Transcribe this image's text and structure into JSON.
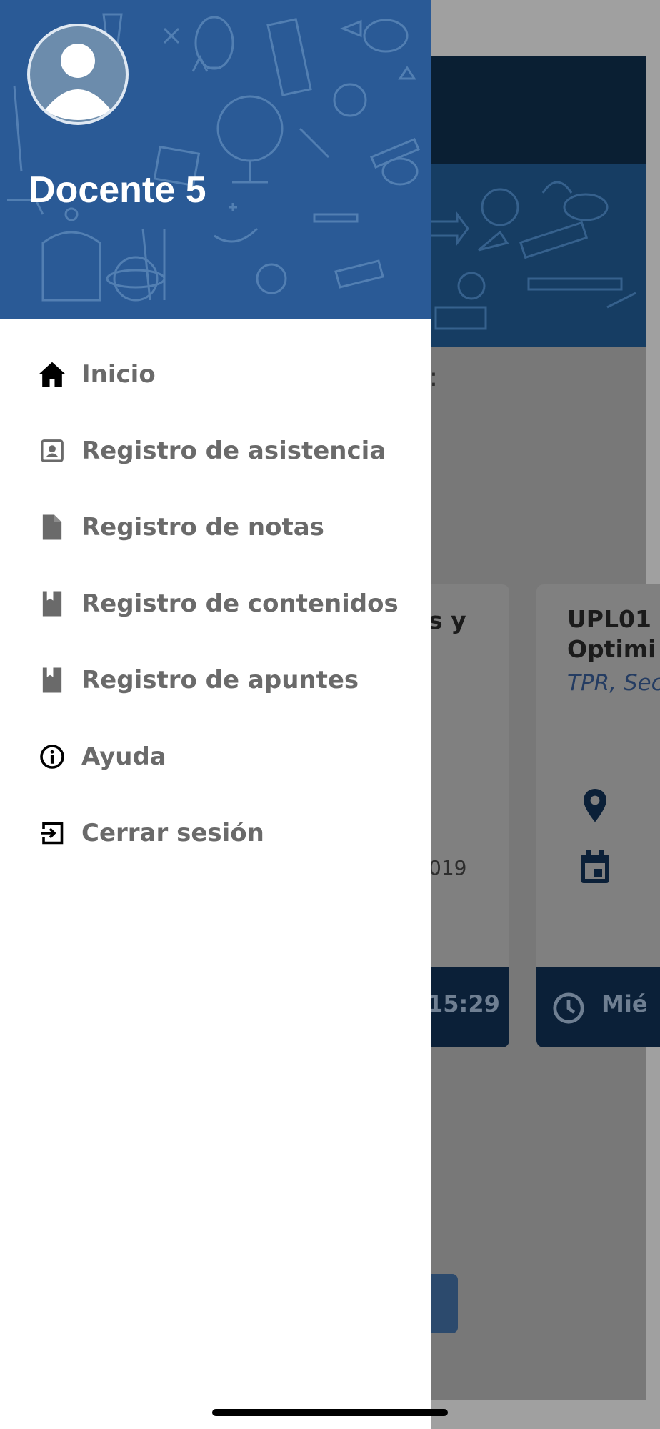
{
  "user": {
    "name": "Docente 5"
  },
  "drawer": {
    "items": [
      {
        "label": "Inicio",
        "icon": "home-icon"
      },
      {
        "label": "Registro de asistencia",
        "icon": "contact-card-icon"
      },
      {
        "label": "Registro de notas",
        "icon": "document-icon"
      },
      {
        "label": "Registro de contenidos",
        "icon": "book-icon"
      },
      {
        "label": "Registro de apuntes",
        "icon": "book-icon"
      },
      {
        "label": "Ayuda",
        "icon": "info-icon"
      },
      {
        "label": "Cerrar sesión",
        "icon": "logout-icon"
      }
    ]
  },
  "background": {
    "prompt_fragment": "se:",
    "card_left": {
      "title_fragment": "s y",
      "date_fragment": "019",
      "time_fragment": "15:29"
    },
    "card_right": {
      "title_line1": "UPL01",
      "title_line2": "Optimi",
      "subtitle": "TPR, Sec",
      "time_fragment": "Mié"
    }
  },
  "colors": {
    "drawer_header": "#2a5a96",
    "app_header": "#0a1f33",
    "label": "#6a6a6a"
  }
}
